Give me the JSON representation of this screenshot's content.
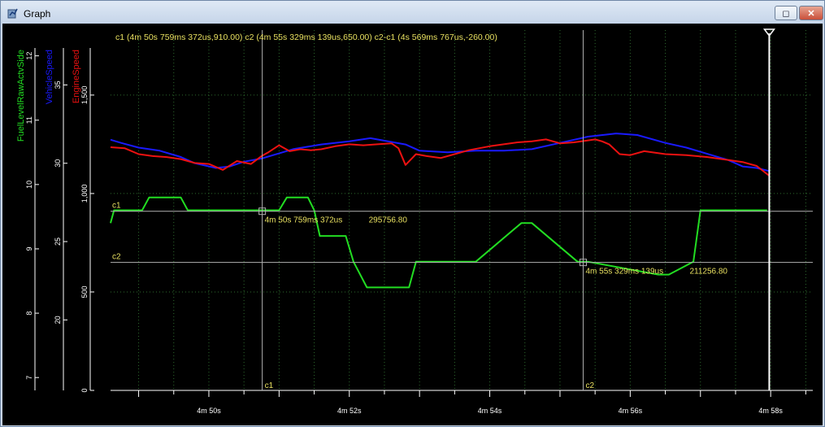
{
  "window": {
    "title": "Graph",
    "restore_glyph": "◻",
    "close_glyph": "✕"
  },
  "colors": {
    "fuel": "#22dd22",
    "vehicle": "#1a1aff",
    "engine": "#ee1111",
    "cursor_text": "#e8e060",
    "grid": "#2e6b2e",
    "axis": "#ffffff",
    "hline": "#b0b0b0"
  },
  "header_text": "c1 (4m 50s 759ms 372us,910.00)  c2 (4m 55s 329ms 139us,650.00)  c2-c1 (4s 569ms 767us,-260.00)",
  "chart_data": {
    "type": "line",
    "x_unit": "seconds",
    "xlim": [
      288.6,
      298.6
    ],
    "x_ticks": [
      {
        "value": 290,
        "label": "4m 50s"
      },
      {
        "value": 292,
        "label": "4m 52s"
      },
      {
        "value": 294,
        "label": "4m 54s"
      },
      {
        "value": 296,
        "label": "4m 56s"
      },
      {
        "value": 298,
        "label": "4m 58s"
      }
    ],
    "axes": [
      {
        "name": "FuelLevelRawActvSide",
        "color": "#22dd22",
        "ylim": [
          6.8,
          12.4
        ],
        "ticks": [
          {
            "value": 7,
            "label": "7"
          },
          {
            "value": 8,
            "label": "8"
          },
          {
            "value": 9,
            "label": "9"
          },
          {
            "value": 10,
            "label": "10"
          },
          {
            "value": 11,
            "label": "11"
          },
          {
            "value": 12,
            "label": "12"
          }
        ]
      },
      {
        "name": "VehicleSpeed",
        "color": "#1a1aff",
        "ylim": [
          15.5,
          38.5
        ],
        "ticks": [
          {
            "value": 20,
            "label": "20"
          },
          {
            "value": 25,
            "label": "25"
          },
          {
            "value": 30,
            "label": "30"
          },
          {
            "value": 35,
            "label": "35"
          }
        ]
      },
      {
        "name": "EngineSpeed",
        "color": "#ee1111",
        "ylim": [
          0,
          1830
        ],
        "ticks": [
          {
            "value": 0,
            "label": "0"
          },
          {
            "value": 500,
            "label": "500"
          },
          {
            "value": 1000,
            "label": "1,000"
          },
          {
            "value": 1500,
            "label": "1,500"
          }
        ]
      }
    ],
    "series": [
      {
        "name": "FuelLevelRawActvSide",
        "axis": 0,
        "x": [
          288.6,
          288.65,
          289.05,
          289.15,
          289.6,
          289.7,
          290.2,
          290.3,
          290.6,
          290.67,
          290.83,
          291.0,
          291.11,
          291.41,
          291.5,
          291.58,
          291.95,
          292.06,
          292.25,
          292.85,
          292.95,
          293.7,
          293.8,
          294.45,
          294.6,
          295.25,
          295.4,
          296.4,
          296.48,
          296.55,
          296.9,
          297.0,
          297.95
        ],
        "values": [
          9.4,
          9.6,
          9.6,
          9.8,
          9.8,
          9.6,
          9.6,
          9.6,
          9.6,
          9.6,
          9.6,
          9.6,
          9.8,
          9.8,
          9.6,
          9.2,
          9.2,
          8.8,
          8.4,
          8.4,
          8.8,
          8.8,
          8.8,
          9.4,
          9.4,
          8.8,
          8.8,
          8.6,
          8.6,
          8.6,
          8.8,
          9.6,
          9.6
        ]
      },
      {
        "name": "VehicleSpeed",
        "axis": 1,
        "x": [
          288.6,
          288.75,
          289.0,
          289.3,
          289.6,
          289.8,
          290.1,
          290.3,
          290.5,
          290.75,
          291.2,
          291.6,
          292.0,
          292.3,
          292.8,
          293.0,
          293.4,
          293.8,
          294.2,
          294.6,
          295.0,
          295.4,
          295.8,
          296.1,
          296.5,
          296.8,
          297.1,
          297.4,
          297.6,
          297.8,
          297.98
        ],
        "values": [
          31.5,
          31.3,
          31.0,
          30.8,
          30.4,
          30.0,
          29.7,
          29.8,
          30.1,
          30.3,
          30.9,
          31.2,
          31.4,
          31.6,
          31.2,
          30.8,
          30.7,
          30.8,
          30.8,
          30.9,
          31.3,
          31.7,
          31.9,
          31.8,
          31.3,
          31.0,
          30.6,
          30.2,
          29.8,
          29.7,
          29.5
        ]
      },
      {
        "name": "EngineSpeed",
        "axis": 2,
        "x": [
          288.6,
          288.8,
          289.0,
          289.2,
          289.4,
          289.6,
          289.8,
          290.0,
          290.2,
          290.4,
          290.6,
          290.75,
          290.85,
          291.0,
          291.15,
          291.3,
          291.45,
          291.6,
          291.8,
          292.0,
          292.2,
          292.4,
          292.6,
          292.7,
          292.8,
          292.95,
          293.1,
          293.3,
          293.5,
          293.7,
          294.0,
          294.2,
          294.4,
          294.6,
          294.8,
          295.0,
          295.2,
          295.4,
          295.5,
          295.6,
          295.7,
          295.85,
          296.0,
          296.2,
          296.5,
          296.8,
          297.1,
          297.4,
          297.6,
          297.8,
          297.98
        ],
        "values": [
          1235,
          1230,
          1200,
          1190,
          1185,
          1175,
          1155,
          1150,
          1120,
          1165,
          1150,
          1190,
          1210,
          1245,
          1215,
          1225,
          1220,
          1225,
          1240,
          1250,
          1245,
          1250,
          1255,
          1230,
          1145,
          1200,
          1190,
          1180,
          1200,
          1220,
          1240,
          1250,
          1260,
          1265,
          1275,
          1255,
          1260,
          1270,
          1275,
          1265,
          1250,
          1200,
          1195,
          1215,
          1200,
          1195,
          1185,
          1170,
          1160,
          1140,
          1090
        ]
      }
    ],
    "cursors": [
      {
        "name": "c1",
        "x": 290.76,
        "y_label": "910.00",
        "time_label": "4m 50s 759ms 372us",
        "value_label": "295756.80"
      },
      {
        "name": "c2",
        "x": 295.33,
        "y_label": "650.00",
        "time_label": "4m 55s 329ms 139us",
        "value_label": "211256.80"
      }
    ],
    "marker": {
      "x": 297.98
    },
    "grid": true
  }
}
